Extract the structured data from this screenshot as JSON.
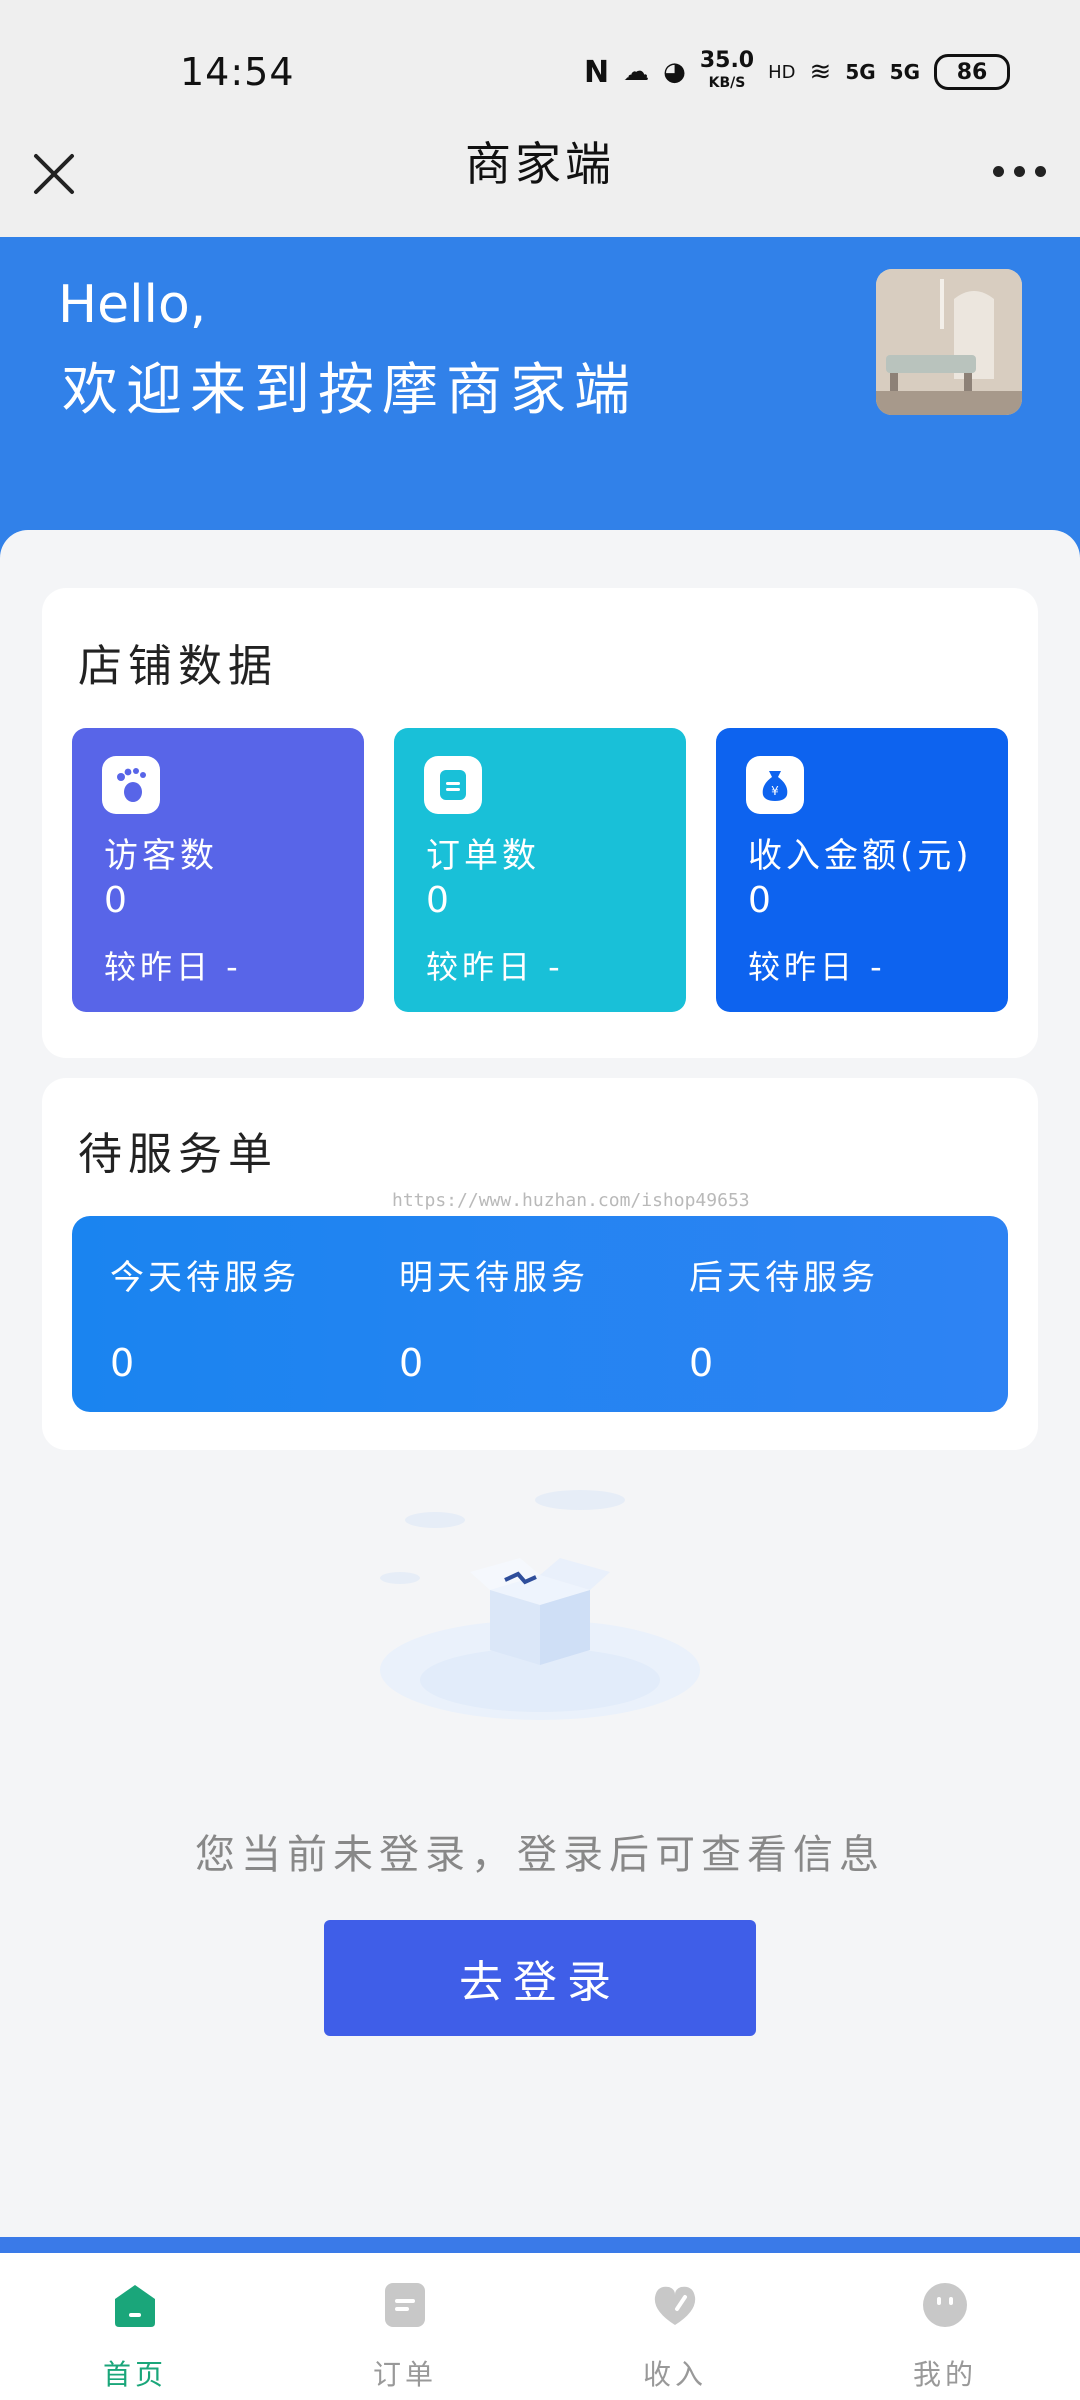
{
  "status_bar": {
    "time": "14:54",
    "net_speed_value": "35.0",
    "net_speed_unit": "KB/S",
    "signal_1": "5G",
    "signal_2": "5G",
    "battery": "86"
  },
  "navbar": {
    "title": "商家端",
    "close_icon": "close-icon",
    "more_icon": "more-icon"
  },
  "hero": {
    "greeting": "Hello,",
    "welcome": "欢迎来到按摩商家端"
  },
  "store_data": {
    "title": "店铺数据",
    "stats": [
      {
        "label": "访客数",
        "value": "0",
        "compare": "较昨日 -",
        "color": "#5865e8",
        "icon": "footprint-icon"
      },
      {
        "label": "订单数",
        "value": "0",
        "compare": "较昨日 -",
        "color": "#19c0d8",
        "icon": "order-icon"
      },
      {
        "label": "收入金额(元)",
        "value": "0",
        "compare": "较昨日 -",
        "color": "#0d63ef",
        "icon": "money-bag-icon"
      }
    ]
  },
  "pending_service": {
    "title": "待服务单",
    "watermark": "https://www.huzhan.com/ishop49653",
    "items": [
      {
        "label": "今天待服务",
        "value": "0"
      },
      {
        "label": "明天待服务",
        "value": "0"
      },
      {
        "label": "后天待服务",
        "value": "0"
      }
    ]
  },
  "empty_state": {
    "message": "您当前未登录，登录后可查看信息",
    "button_label": "去登录"
  },
  "tabbar": {
    "tabs": [
      {
        "label": "首页",
        "icon": "home-icon",
        "active": true
      },
      {
        "label": "订单",
        "icon": "order-list-icon",
        "active": false
      },
      {
        "label": "收入",
        "icon": "income-icon",
        "active": false
      },
      {
        "label": "我的",
        "icon": "profile-icon",
        "active": false
      }
    ],
    "active_color": "#1aa67a",
    "inactive_color": "#c8c8c8"
  }
}
